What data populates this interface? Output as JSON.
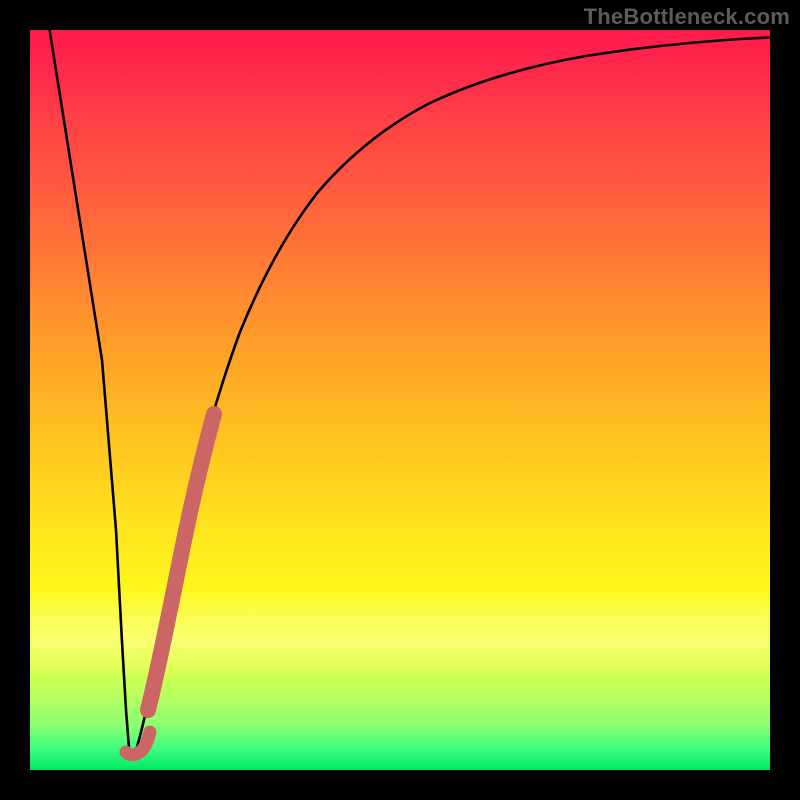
{
  "watermark": "TheBottleneck.com",
  "colors": {
    "frame": "#000000",
    "curve": "#000000",
    "marker": "#cc6666",
    "gradient_top": "#ff1a4d",
    "gradient_bottom": "#00e860"
  },
  "chart_data": {
    "type": "line",
    "title": "",
    "xlabel": "",
    "ylabel": "",
    "xlim": [
      0,
      100
    ],
    "ylim": [
      0,
      100
    ],
    "series": [
      {
        "name": "bottleneck-curve",
        "x": [
          0,
          5,
          9,
          11,
          12,
          13,
          14,
          15,
          16,
          18,
          20,
          22,
          24,
          26,
          28,
          30,
          33,
          36,
          40,
          45,
          50,
          55,
          60,
          65,
          70,
          75,
          80,
          85,
          90,
          95,
          100
        ],
        "values": [
          100,
          57,
          22,
          5,
          0.5,
          1,
          3,
          8,
          15,
          28,
          40,
          49,
          56,
          62,
          67,
          71,
          76,
          80,
          83,
          86,
          88.5,
          90.5,
          92,
          93.2,
          94.2,
          95,
          95.7,
          96.3,
          96.8,
          97.2,
          97.5
        ]
      }
    ],
    "annotations": [
      {
        "name": "highlight-segment",
        "x_start": 16.5,
        "y_start": 7,
        "x_end": 22,
        "y_end": 48
      },
      {
        "name": "minimum-dot",
        "x": 12.2,
        "y": 0.8
      }
    ]
  }
}
